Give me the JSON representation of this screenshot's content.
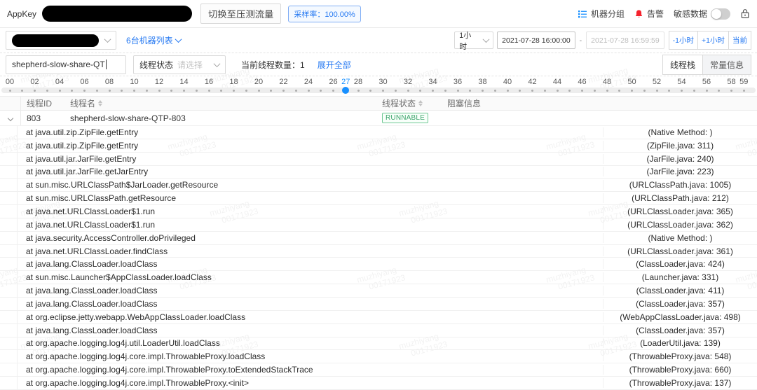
{
  "watermark": {
    "line1": "muzhiyang",
    "line2": "00171923"
  },
  "topbar": {
    "appkey_label": "AppKey",
    "switch_button": "切换至压测流量",
    "sample_rate_badge": "采样率：100.00%",
    "machine_group": "机器分组",
    "alert": "告警",
    "sensitive_data": "敏感数据"
  },
  "toolbar": {
    "machine_list_link": "6台机器列表",
    "duration_select": "1小时",
    "time_start": "2021-07-28 16:00:00",
    "range_separator": "-",
    "time_end": "2021-07-28 16:59:59",
    "minus_hour_button": "-1小时",
    "plus_hour_button": "+1小时",
    "now_button": "当前"
  },
  "filterbar": {
    "thread_name_value": "shepherd-slow-share-QT",
    "thread_state_label": "线程状态",
    "thread_state_placeholder": "请选择",
    "thread_count_text": "当前线程数量：1",
    "expand_all_link": "展开全部",
    "tab_thread_stack": "线程栈",
    "tab_constant_info": "常量信息"
  },
  "timeline": {
    "selected_minute": 27,
    "total_minutes": 60,
    "labels": [
      {
        "t": "00",
        "m": 0
      },
      {
        "t": "02",
        "m": 2
      },
      {
        "t": "04",
        "m": 4
      },
      {
        "t": "06",
        "m": 6
      },
      {
        "t": "08",
        "m": 8
      },
      {
        "t": "10",
        "m": 10
      },
      {
        "t": "12",
        "m": 12
      },
      {
        "t": "14",
        "m": 14
      },
      {
        "t": "16",
        "m": 16
      },
      {
        "t": "18",
        "m": 18
      },
      {
        "t": "20",
        "m": 20
      },
      {
        "t": "22",
        "m": 22
      },
      {
        "t": "24",
        "m": 24
      },
      {
        "t": "26",
        "m": 26
      },
      {
        "t": "27",
        "m": 27
      },
      {
        "t": "28",
        "m": 28
      },
      {
        "t": "30",
        "m": 30
      },
      {
        "t": "32",
        "m": 32
      },
      {
        "t": "34",
        "m": 34
      },
      {
        "t": "36",
        "m": 36
      },
      {
        "t": "38",
        "m": 38
      },
      {
        "t": "40",
        "m": 40
      },
      {
        "t": "42",
        "m": 42
      },
      {
        "t": "44",
        "m": 44
      },
      {
        "t": "46",
        "m": 46
      },
      {
        "t": "48",
        "m": 48
      },
      {
        "t": "50",
        "m": 50
      },
      {
        "t": "52",
        "m": 52
      },
      {
        "t": "54",
        "m": 54
      },
      {
        "t": "56",
        "m": 56
      },
      {
        "t": "58",
        "m": 58
      },
      {
        "t": "59",
        "m": 59
      }
    ]
  },
  "table": {
    "columns": {
      "thread_id": "线程ID",
      "thread_name": "线程名",
      "thread_state": "线程状态",
      "block_info": "阻塞信息"
    },
    "row": {
      "id": "803",
      "name": "shepherd-slow-share-QTP-803",
      "state": "RUNNABLE",
      "block_info": ""
    },
    "stack": [
      {
        "frame": "at java.util.zip.ZipFile.getEntry",
        "loc": "(Native Method: )"
      },
      {
        "frame": "at java.util.zip.ZipFile.getEntry",
        "loc": "(ZipFile.java: 311)"
      },
      {
        "frame": "at java.util.jar.JarFile.getEntry",
        "loc": "(JarFile.java: 240)"
      },
      {
        "frame": "at java.util.jar.JarFile.getJarEntry",
        "loc": "(JarFile.java: 223)"
      },
      {
        "frame": "at sun.misc.URLClassPath$JarLoader.getResource",
        "loc": "(URLClassPath.java: 1005)"
      },
      {
        "frame": "at sun.misc.URLClassPath.getResource",
        "loc": "(URLClassPath.java: 212)"
      },
      {
        "frame": "at java.net.URLClassLoader$1.run",
        "loc": "(URLClassLoader.java: 365)"
      },
      {
        "frame": "at java.net.URLClassLoader$1.run",
        "loc": "(URLClassLoader.java: 362)"
      },
      {
        "frame": "at java.security.AccessController.doPrivileged",
        "loc": "(Native Method: )"
      },
      {
        "frame": "at java.net.URLClassLoader.findClass",
        "loc": "(URLClassLoader.java: 361)"
      },
      {
        "frame": "at java.lang.ClassLoader.loadClass",
        "loc": "(ClassLoader.java: 424)"
      },
      {
        "frame": "at sun.misc.Launcher$AppClassLoader.loadClass",
        "loc": "(Launcher.java: 331)"
      },
      {
        "frame": "at java.lang.ClassLoader.loadClass",
        "loc": "(ClassLoader.java: 411)"
      },
      {
        "frame": "at java.lang.ClassLoader.loadClass",
        "loc": "(ClassLoader.java: 357)"
      },
      {
        "frame": "at org.eclipse.jetty.webapp.WebAppClassLoader.loadClass",
        "loc": "(WebAppClassLoader.java: 498)"
      },
      {
        "frame": "at java.lang.ClassLoader.loadClass",
        "loc": "(ClassLoader.java: 357)"
      },
      {
        "frame": "at org.apache.logging.log4j.util.LoaderUtil.loadClass",
        "loc": "(LoaderUtil.java: 139)"
      },
      {
        "frame": "at org.apache.logging.log4j.core.impl.ThrowableProxy.loadClass",
        "loc": "(ThrowableProxy.java: 548)"
      },
      {
        "frame": "at org.apache.logging.log4j.core.impl.ThrowableProxy.toExtendedStackTrace",
        "loc": "(ThrowableProxy.java: 660)"
      },
      {
        "frame": "at org.apache.logging.log4j.core.impl.ThrowableProxy.<init>",
        "loc": "(ThrowableProxy.java: 137)"
      }
    ]
  },
  "colors": {
    "accent_blue": "#1890ff",
    "link_blue": "#2478f2",
    "alert_red": "#f5222d",
    "state_green": "#3aa46a",
    "border_gray": "#d9d9d9"
  }
}
